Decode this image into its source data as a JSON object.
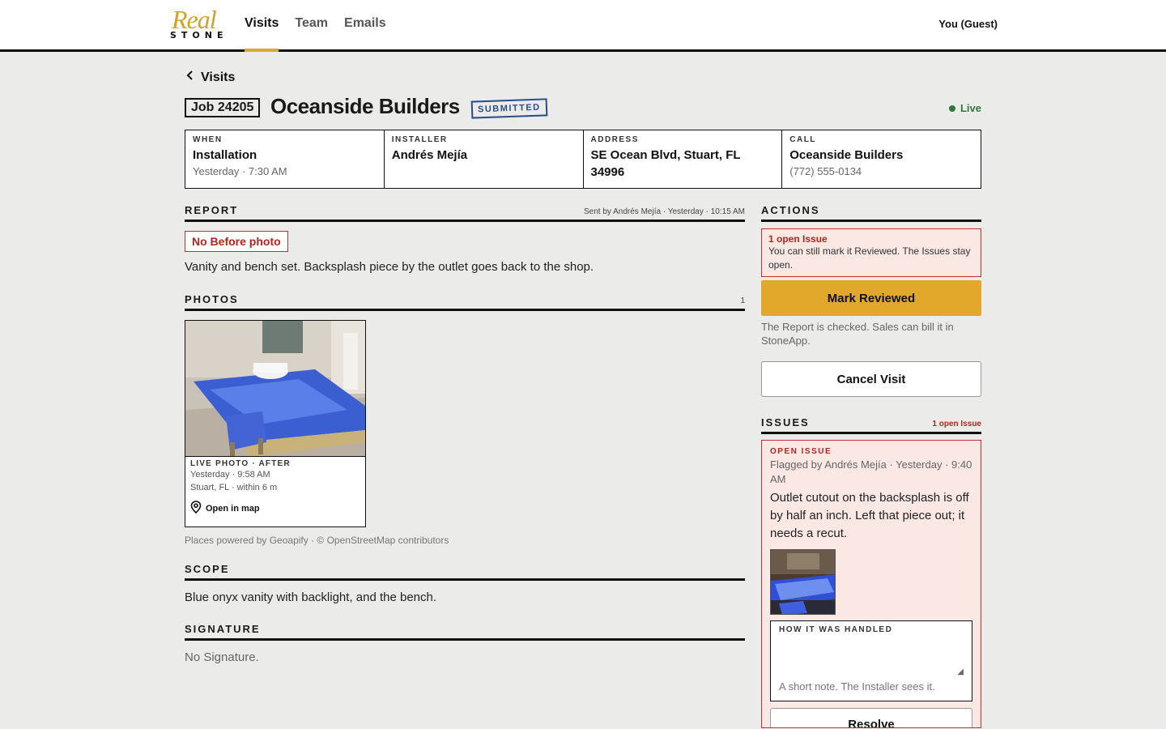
{
  "brand": {
    "script": "Real",
    "word": "STONE"
  },
  "nav": {
    "items": [
      {
        "label": "Visits"
      },
      {
        "label": "Team"
      },
      {
        "label": "Emails"
      }
    ],
    "active": "Visits"
  },
  "user": "You (Guest)",
  "header": {
    "back_label": "Visits",
    "job": "Job 24205",
    "title": "Oceanside Builders",
    "status": "SUBMITTED",
    "live": "Live"
  },
  "info": [
    {
      "label": "WHEN",
      "main": "Installation",
      "sub": "Yesterday · 7:30 AM"
    },
    {
      "label": "INSTALLER",
      "main": "Andrés Mejía",
      "sub": ""
    },
    {
      "label": "ADDRESS",
      "main": "SE Ocean Blvd, Stuart, FL 34996",
      "sub": ""
    },
    {
      "label": "CALL",
      "main": "Oceanside Builders",
      "sub": "(772) 555-0134"
    }
  ],
  "report": {
    "heading": "REPORT",
    "sent": "Sent by Andrés Mejía · Yesterday · 10:15 AM",
    "warning": "No Before photo",
    "text": "Vanity and bench set. Backsplash piece by the outlet goes back to the shop."
  },
  "photos": {
    "heading": "PHOTOS",
    "count": "1",
    "card": {
      "kind": "LIVE PHOTO · AFTER",
      "time": "Yesterday · 9:58 AM",
      "place": "Stuart, FL · within 6 m",
      "open_map": "Open in map"
    },
    "credit": "Places powered by Geoapify · © OpenStreetMap contributors"
  },
  "scope": {
    "heading": "SCOPE",
    "text": "Blue onyx vanity with backlight, and the bench."
  },
  "signature": {
    "heading": "SIGNATURE",
    "text": "No Signature."
  },
  "actions": {
    "heading": "ACTIONS",
    "alert_title": "1 open Issue",
    "alert_text": "You can still mark it Reviewed. The Issues stay open.",
    "primary": "Mark Reviewed",
    "hint": "The Report is checked. Sales can bill it in StoneApp.",
    "cancel": "Cancel Visit"
  },
  "issues": {
    "heading": "ISSUES",
    "count": "1 open Issue",
    "item": {
      "type": "OPEN ISSUE",
      "flagged": "Flagged by Andrés Mejía · Yesterday · 9:40 AM",
      "description": "Outlet cutout on the backsplash is off by half an inch. Left that piece out; it needs a recut.",
      "handled_label": "HOW IT WAS HANDLED",
      "handled_placeholder": "A short note. The Installer sees it.",
      "resolve": "Resolve"
    }
  },
  "colors": {
    "accent": "#e2a82c",
    "danger": "#b3261e",
    "status_blue": "#2a4d8a",
    "live_green": "#2f7a3c"
  }
}
